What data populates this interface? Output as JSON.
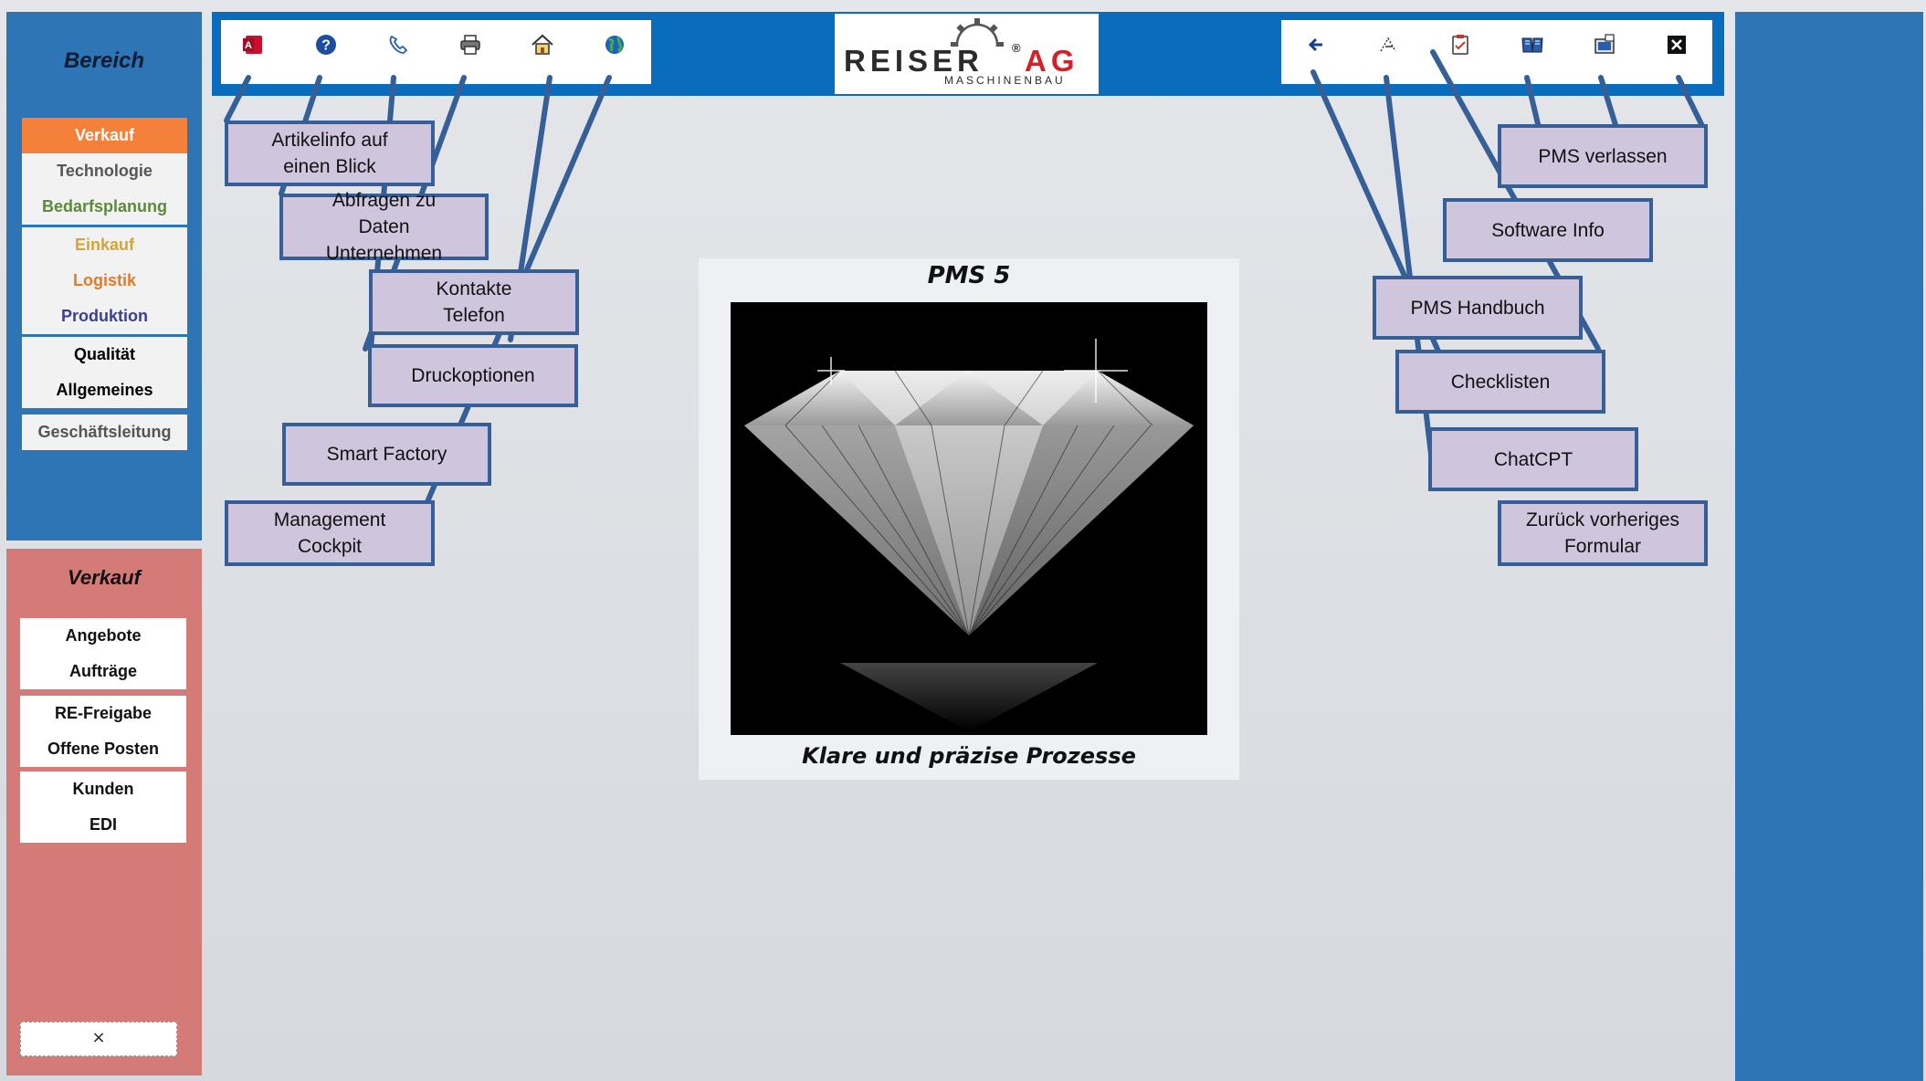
{
  "sidebar": {
    "title": "Bereich",
    "groups": [
      [
        {
          "label": "Verkauf",
          "color": "#ffffff",
          "active": true
        },
        {
          "label": "Technologie",
          "color": "#555555"
        },
        {
          "label": "Bedarfsplanung",
          "color": "#5b8a3a"
        }
      ],
      [
        {
          "label": "Einkauf",
          "color": "#d4a537"
        },
        {
          "label": "Logistik",
          "color": "#e07b2a"
        },
        {
          "label": "Produktion",
          "color": "#3b3f8f"
        }
      ],
      [
        {
          "label": "Qualität",
          "color": "#111111"
        },
        {
          "label": "Allgemeines",
          "color": "#111111"
        }
      ],
      [
        {
          "label": "Geschäftsleitung",
          "color": "#555555"
        }
      ]
    ]
  },
  "subpanel": {
    "title": "Verkauf",
    "groups": [
      [
        "Angebote",
        "Aufträge"
      ],
      [
        "RE-Freigabe",
        "Offene Posten"
      ],
      [
        "Kunden",
        "EDI"
      ]
    ],
    "close_label": "×"
  },
  "toolbar_left": [
    {
      "name": "access-icon"
    },
    {
      "name": "help-icon"
    },
    {
      "name": "phone-icon"
    },
    {
      "name": "printer-icon"
    },
    {
      "name": "home-icon"
    },
    {
      "name": "globe-icon"
    }
  ],
  "toolbar_right": [
    {
      "name": "back-arrow-icon"
    },
    {
      "name": "chatgpt-icon"
    },
    {
      "name": "checklist-icon"
    },
    {
      "name": "handbook-icon"
    },
    {
      "name": "software-info-icon"
    },
    {
      "name": "exit-icon"
    }
  ],
  "logo": {
    "main_left": "REISER",
    "main_right": "AG",
    "sub": "MASCHINENBAU",
    "registered": "®",
    "colors": {
      "dark": "#2b2b2b",
      "red": "#d42027"
    }
  },
  "card": {
    "title": "PMS 5",
    "caption": "Klare und präzise Prozesse"
  },
  "callouts_left": [
    {
      "text": "Artikelinfo auf\neinen Blick"
    },
    {
      "text": "Abfragen zu\nDaten\nUnternehmen"
    },
    {
      "text": "Kontakte\nTelefon"
    },
    {
      "text": "Druckoptionen"
    },
    {
      "text": "Smart Factory"
    },
    {
      "text": "Management\nCockpit"
    }
  ],
  "callouts_right": [
    {
      "text": "PMS verlassen"
    },
    {
      "text": "Software Info"
    },
    {
      "text": "PMS Handbuch"
    },
    {
      "text": "Checklisten"
    },
    {
      "text": "ChatCPT"
    },
    {
      "text": "Zurück vorheriges\nFormular"
    }
  ],
  "colors": {
    "panel_blue": "#2e75b6",
    "topbar_blue": "#0a6cbd",
    "panel_red": "#d47b78",
    "active_orange": "#f4803a",
    "callout_fill": "#cfc6de",
    "callout_border": "#355f96"
  }
}
